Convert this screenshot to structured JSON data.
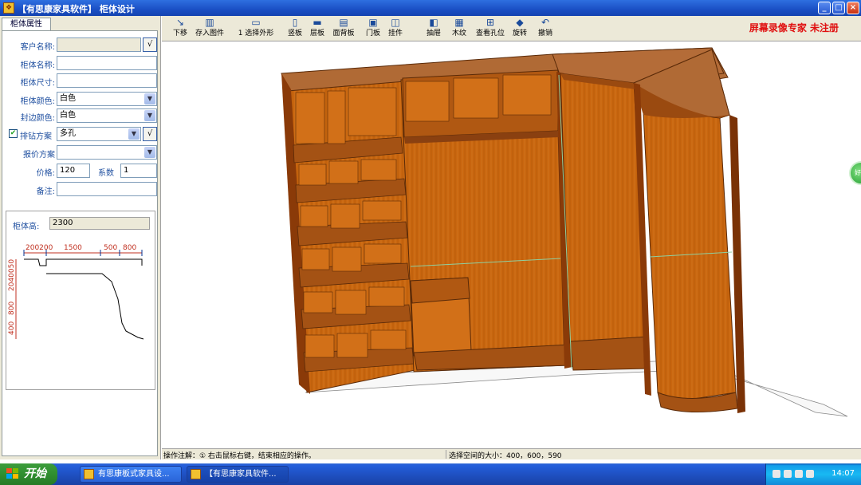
{
  "window": {
    "title": "【有思康家具软件】  柜体设计",
    "buttons": {
      "minimize": "_",
      "maximize": "□",
      "close": "×"
    }
  },
  "left_panel": {
    "tab": "柜体属性",
    "fields": {
      "customer_name": {
        "label": "客户名称:",
        "value": "",
        "ok": "√"
      },
      "cabinet_name": {
        "label": "柜体名称:",
        "value": ""
      },
      "cabinet_size": {
        "label": "柜体尺寸:",
        "value": ""
      },
      "cabinet_color": {
        "label": "柜体颜色:",
        "value": "白色"
      },
      "edge_color": {
        "label": "封边颜色:",
        "value": "白色"
      },
      "hole_plan": {
        "label": "排钻方案",
        "value": "多孔",
        "ok": "√",
        "checked": true
      },
      "price_plan": {
        "label": "报价方案",
        "value": ""
      },
      "price": {
        "label": "价格:",
        "value": "120"
      },
      "coefficient": {
        "label": "系数",
        "value": "1"
      },
      "note": {
        "label": "备注:",
        "value": ""
      }
    },
    "preview": {
      "height_label": "柜体高:",
      "height_value": "2300",
      "dim_top": [
        "200200",
        "1500",
        "500",
        "800"
      ],
      "dim_side": "2040050",
      "dim_side2": "800",
      "dim_side3": "400"
    }
  },
  "toolbar": {
    "buttons": [
      {
        "id": "tool-down",
        "label": "下移",
        "icon": "↘"
      },
      {
        "id": "tool-save-part",
        "label": "存入图件",
        "icon": "▥"
      },
      {
        "id": "tool-select-outline",
        "label": "1 选择外形",
        "icon": "▭"
      },
      {
        "id": "tool-vertical-panel",
        "label": "竖板",
        "icon": "▯"
      },
      {
        "id": "tool-horizontal-panel",
        "label": "层板",
        "icon": "▬"
      },
      {
        "id": "tool-back-panel",
        "label": "面背板",
        "icon": "▤"
      },
      {
        "id": "tool-door-panel",
        "label": "门板",
        "icon": "▣"
      },
      {
        "id": "tool-hardware",
        "label": "挂件",
        "icon": "◫"
      },
      {
        "id": "tool-drawer",
        "label": "抽屉",
        "icon": "◧"
      },
      {
        "id": "tool-wood",
        "label": "木纹",
        "icon": "▦"
      },
      {
        "id": "tool-holes",
        "label": "查看孔位",
        "icon": "⊞"
      },
      {
        "id": "tool-rotate",
        "label": "旋转",
        "icon": "◆"
      },
      {
        "id": "tool-undo",
        "label": "撤销",
        "icon": "↶"
      }
    ],
    "brand": "屏幕录像专家  未注册"
  },
  "canvas": {
    "badge": "好评"
  },
  "status": {
    "left": "操作注解：①  右击鼠标右键，结束相应的操作。",
    "right": "选择空间的大小：400，600，590"
  },
  "taskbar": {
    "start": "开始",
    "tasks": [
      "有思康板式家具设...",
      "【有思康家具软件..."
    ],
    "clock": "14:07"
  },
  "colors": {
    "wood": "#c8600e",
    "wood_dark": "#8a3a08",
    "wood_top": "#b86a30",
    "titlebar": "#1a4fc4"
  }
}
